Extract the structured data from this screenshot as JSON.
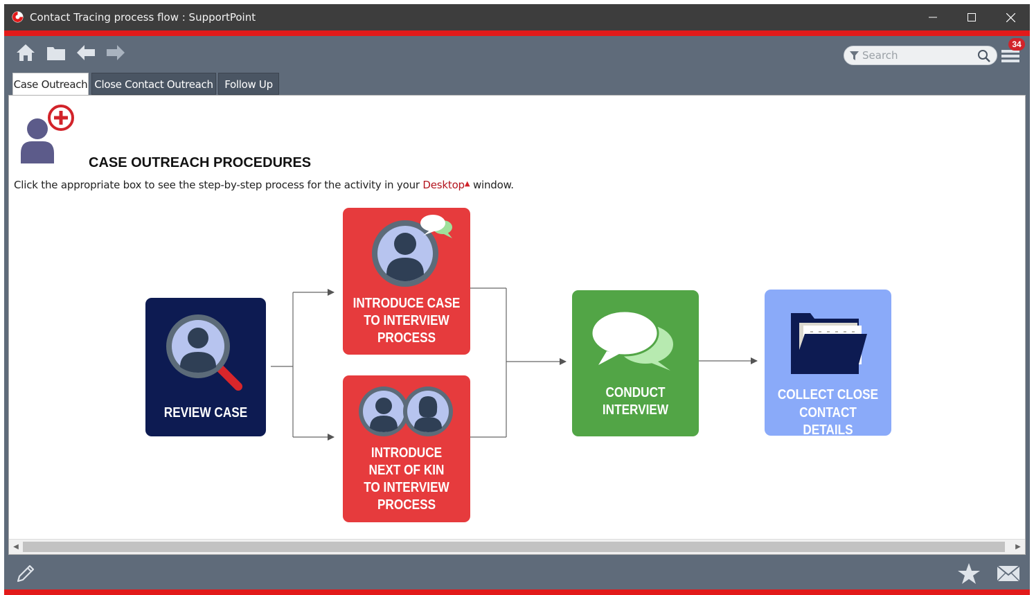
{
  "window": {
    "title": "Contact Tracing process flow : SupportPoint",
    "controls": [
      "minimize-icon",
      "maximize-icon",
      "close-icon"
    ]
  },
  "toolbar": {
    "icons": [
      "home-icon",
      "folder-icon",
      "back-arrow-icon",
      "forward-arrow-icon"
    ],
    "search_placeholder": "Search",
    "notification_count": "34"
  },
  "tabs": [
    {
      "label": "Case Outreach",
      "active": true
    },
    {
      "label": "Close Contact Outreach",
      "active": false
    },
    {
      "label": "Follow Up",
      "active": false
    }
  ],
  "page": {
    "heading": "CASE OUTREACH PROCEDURES",
    "instruction_before": "Click the appropriate box to see the step-by-step process for the activity in your ",
    "instruction_link": "Desktop",
    "instruction_after": " window."
  },
  "flow": {
    "review_case": {
      "lines": [
        "REVIEW CASE"
      ],
      "color": "#0d1b52"
    },
    "introduce_case": {
      "lines": [
        "INTRODUCE CASE",
        "TO INTERVIEW",
        "PROCESS"
      ],
      "color": "#e63b3d"
    },
    "introduce_kin": {
      "lines": [
        "INTRODUCE",
        "NEXT OF KIN",
        "TO INTERVIEW",
        "PROCESS"
      ],
      "color": "#e63b3d"
    },
    "conduct_interview": {
      "lines": [
        "CONDUCT",
        "INTERVIEW"
      ],
      "color": "#52a546"
    },
    "collect_contacts": {
      "lines": [
        "COLLECT CLOSE",
        "CONTACT DETAILS"
      ],
      "color": "#8aaaf9"
    }
  },
  "statusbar": {
    "icons": [
      "pencil-icon",
      "star-icon",
      "mail-icon"
    ]
  },
  "colors": {
    "accent_red": "#e21a1a",
    "chrome": "#5f6b7a",
    "titlebar": "#3d3d3d"
  }
}
